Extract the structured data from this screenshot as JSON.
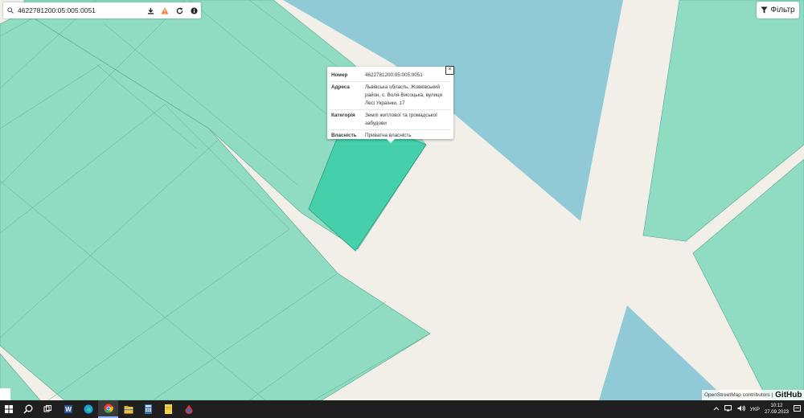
{
  "search": {
    "value": "4622781200:05:005:0051"
  },
  "filter": {
    "label": "Фільтр"
  },
  "popup": {
    "rows": [
      {
        "key": "Номер",
        "value": "4622781200:05:005:0051"
      },
      {
        "key": "Адреса",
        "value": "Львівська область, Жовківський район, с. Воля-Висоцька, вулиця Лесі Українки, 17"
      },
      {
        "key": "Категорія",
        "value": "Землі житлової та громадської забудови"
      },
      {
        "key": "Власність",
        "value": "Приватна власність"
      }
    ],
    "close": "×"
  },
  "attribution": {
    "text": "OpenStreetMap contributors |",
    "brand": "GitHub"
  },
  "taskbar": {
    "icons": [
      "windows-start-icon",
      "search-icon",
      "task-view-icon",
      "word-icon",
      "edge-icon",
      "chrome-icon",
      "file-explorer-icon",
      "calculator-icon",
      "notes-icon",
      "drop-app-icon"
    ],
    "lang": "УКР",
    "time": "10:12",
    "date": "27.09.2023"
  },
  "colors": {
    "parcel": "#8fdcc2",
    "selected": "#45cfab",
    "water": "#90cad6",
    "road": "#f2efe9"
  }
}
